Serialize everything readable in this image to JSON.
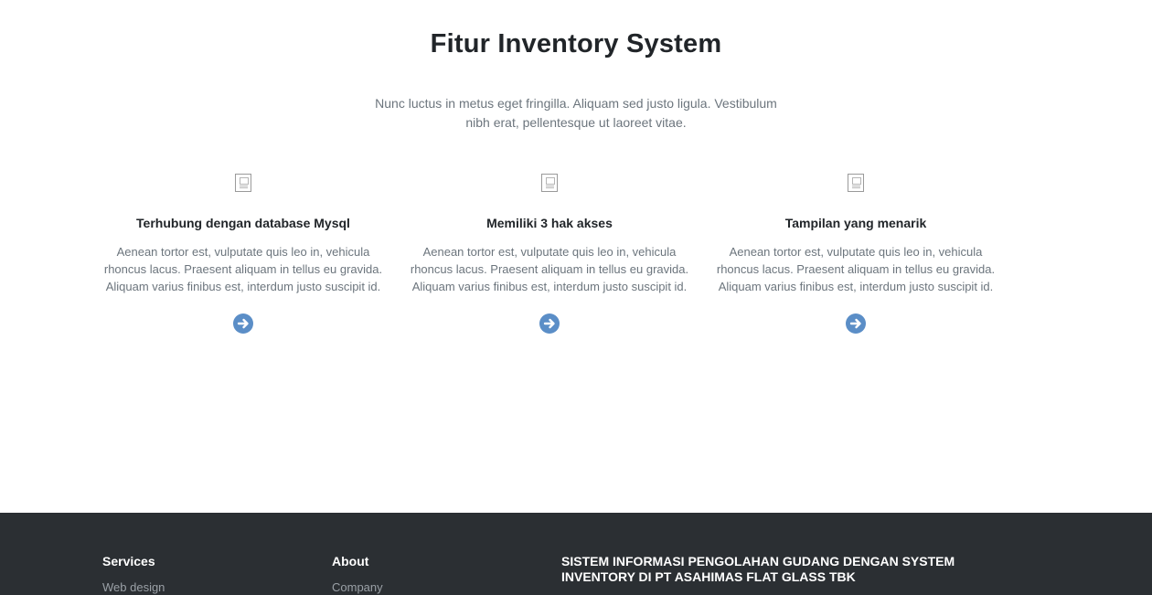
{
  "features_section": {
    "title": "Fitur Inventory System",
    "lead": "Nunc luctus in metus eget fringilla. Aliquam sed justo ligula. Vestibulum nibh erat, pellentesque ut laoreet vitae.",
    "items": [
      {
        "icon": "broken-image-icon",
        "title": "Terhubung dengan database Mysql",
        "text": "Aenean tortor est, vulputate quis leo in, vehicula rhoncus lacus. Praesent aliquam in tellus eu gravida. Aliquam varius finibus est, interdum justo suscipit id.",
        "link_icon": "arrow-circle-right-icon"
      },
      {
        "icon": "broken-image-icon",
        "title": "Memiliki 3 hak akses",
        "text": "Aenean tortor est, vulputate quis leo in, vehicula rhoncus lacus. Praesent aliquam in tellus eu gravida. Aliquam varius finibus est, interdum justo suscipit id.",
        "link_icon": "arrow-circle-right-icon"
      },
      {
        "icon": "broken-image-icon",
        "title": "Tampilan yang menarik",
        "text": "Aenean tortor est, vulputate quis leo in, vehicula rhoncus lacus. Praesent aliquam in tellus eu gravida. Aliquam varius finibus est, interdum justo suscipit id.",
        "link_icon": "arrow-circle-right-icon"
      }
    ]
  },
  "footer": {
    "services": {
      "heading": "Services",
      "links": [
        "Web design"
      ]
    },
    "about": {
      "heading": "About",
      "links": [
        "Company"
      ]
    },
    "brand": {
      "heading": "SISTEM INFORMASI PENGOLAHAN GUDANG DENGAN SYSTEM INVENTORY DI PT ASAHIMAS FLAT GLASS tbk"
    }
  },
  "colors": {
    "accent": "#5b8ec7",
    "footer_bg": "#2b2f33",
    "heading": "#212529",
    "muted": "#6c757d"
  }
}
